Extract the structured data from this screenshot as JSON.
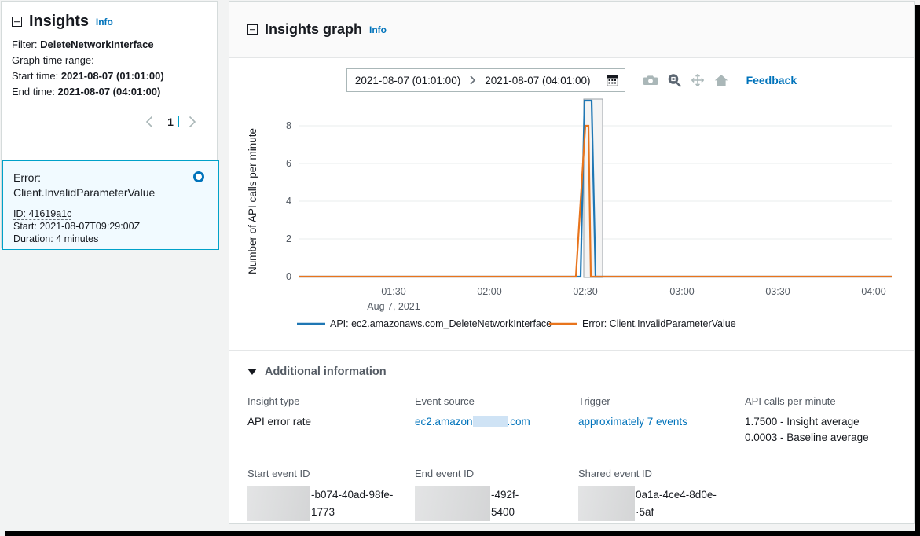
{
  "insights_panel": {
    "title": "Insights",
    "info_label": "Info",
    "filter_label": "Filter:",
    "filter_value": "DeleteNetworkInterface",
    "graph_time_range_label": "Graph time range:",
    "start_time_label": "Start time:",
    "start_time_value": "2021-08-07 (01:01:00)",
    "end_time_label": "End time:",
    "end_time_value": "2021-08-07 (04:01:00)",
    "pagination": {
      "prev_icon": "chevron-left-icon",
      "current_page": "1",
      "next_icon": "chevron-right-icon"
    },
    "card": {
      "error_label": "Error:",
      "error_value": "Client.InvalidParameterValue",
      "id_line": "ID: 41619a1c",
      "start_line": "Start: 2021-08-07T09:29:00Z",
      "duration_line": "Duration: 4 minutes",
      "selected": true,
      "border_color": "#00a1c9",
      "fill_color": "#f1faff",
      "radio_color": "#0073bb"
    }
  },
  "graph_panel": {
    "title": "Insights graph",
    "info_label": "Info",
    "toolbar": {
      "range_start": "2021-08-07 (01:01:00)",
      "range_separator": "chevron-right-icon",
      "range_end": "2021-08-07 (04:01:00)",
      "calendar_icon": "calendar-icon",
      "icons": [
        "camera-icon",
        "zoom-icon",
        "pan-move-icon",
        "home-icon"
      ],
      "feedback_label": "Feedback"
    }
  },
  "chart_data": {
    "type": "line",
    "title": "",
    "xlabel": "Aug 7, 2021",
    "ylabel": "Number of API calls per minute",
    "ylim": [
      0,
      9.4
    ],
    "yticks": [
      0,
      2,
      4,
      6,
      8
    ],
    "xticks": [
      "01:30",
      "02:00",
      "02:30",
      "03:00",
      "03:30",
      "04:00"
    ],
    "x_range_start": "01:01",
    "x_range_end": "04:01",
    "grid": true,
    "legend_position": "bottom",
    "highlight_band": {
      "start": "02:29",
      "end": "02:33",
      "color": "#f2f3f3"
    },
    "series": [
      {
        "name": "API: ec2.amazonaws.com_DeleteNetworkInterface",
        "color": "#1f77b4",
        "points": [
          {
            "t": "01:01",
            "v": 0
          },
          {
            "t": "02:26",
            "v": 0
          },
          {
            "t": "02:29",
            "v": 9.3
          },
          {
            "t": "02:31",
            "v": 9.3
          },
          {
            "t": "02:34",
            "v": 0
          },
          {
            "t": "04:01",
            "v": 0
          }
        ]
      },
      {
        "name": "Error: Client.InvalidParameterValue",
        "color": "#e8741c",
        "points": [
          {
            "t": "01:01",
            "v": 0
          },
          {
            "t": "02:25",
            "v": 0
          },
          {
            "t": "02:29",
            "v": 8.0
          },
          {
            "t": "02:30",
            "v": 8.0
          },
          {
            "t": "02:31",
            "v": 0
          },
          {
            "t": "04:01",
            "v": 0
          }
        ]
      }
    ]
  },
  "additional_information": {
    "section_title": "Additional information",
    "expanded": true,
    "row1": [
      {
        "label": "Insight type",
        "value": "API error rate",
        "link": false
      },
      {
        "label": "Event source",
        "value_prefix": "ec2.amazon",
        "value_suffix": ".com",
        "redacted": true,
        "link": true
      },
      {
        "label": "Trigger",
        "value": "approximately 7 events",
        "link": true
      },
      {
        "label": "API calls per minute",
        "value": "1.7500 - Insight average",
        "value2": "0.0003 - Baseline average",
        "link": false
      }
    ],
    "row2": [
      {
        "label": "Start event ID",
        "redacted": true,
        "line1": "-b074-40ad-98fe-",
        "line2": "1773"
      },
      {
        "label": "End event ID",
        "redacted": true,
        "line1": "-492f-",
        "line2": "5400"
      },
      {
        "label": "Shared event ID",
        "redacted": true,
        "line1": "0a1a-4ce4-8d0e-",
        "line2": "·5af"
      }
    ]
  }
}
